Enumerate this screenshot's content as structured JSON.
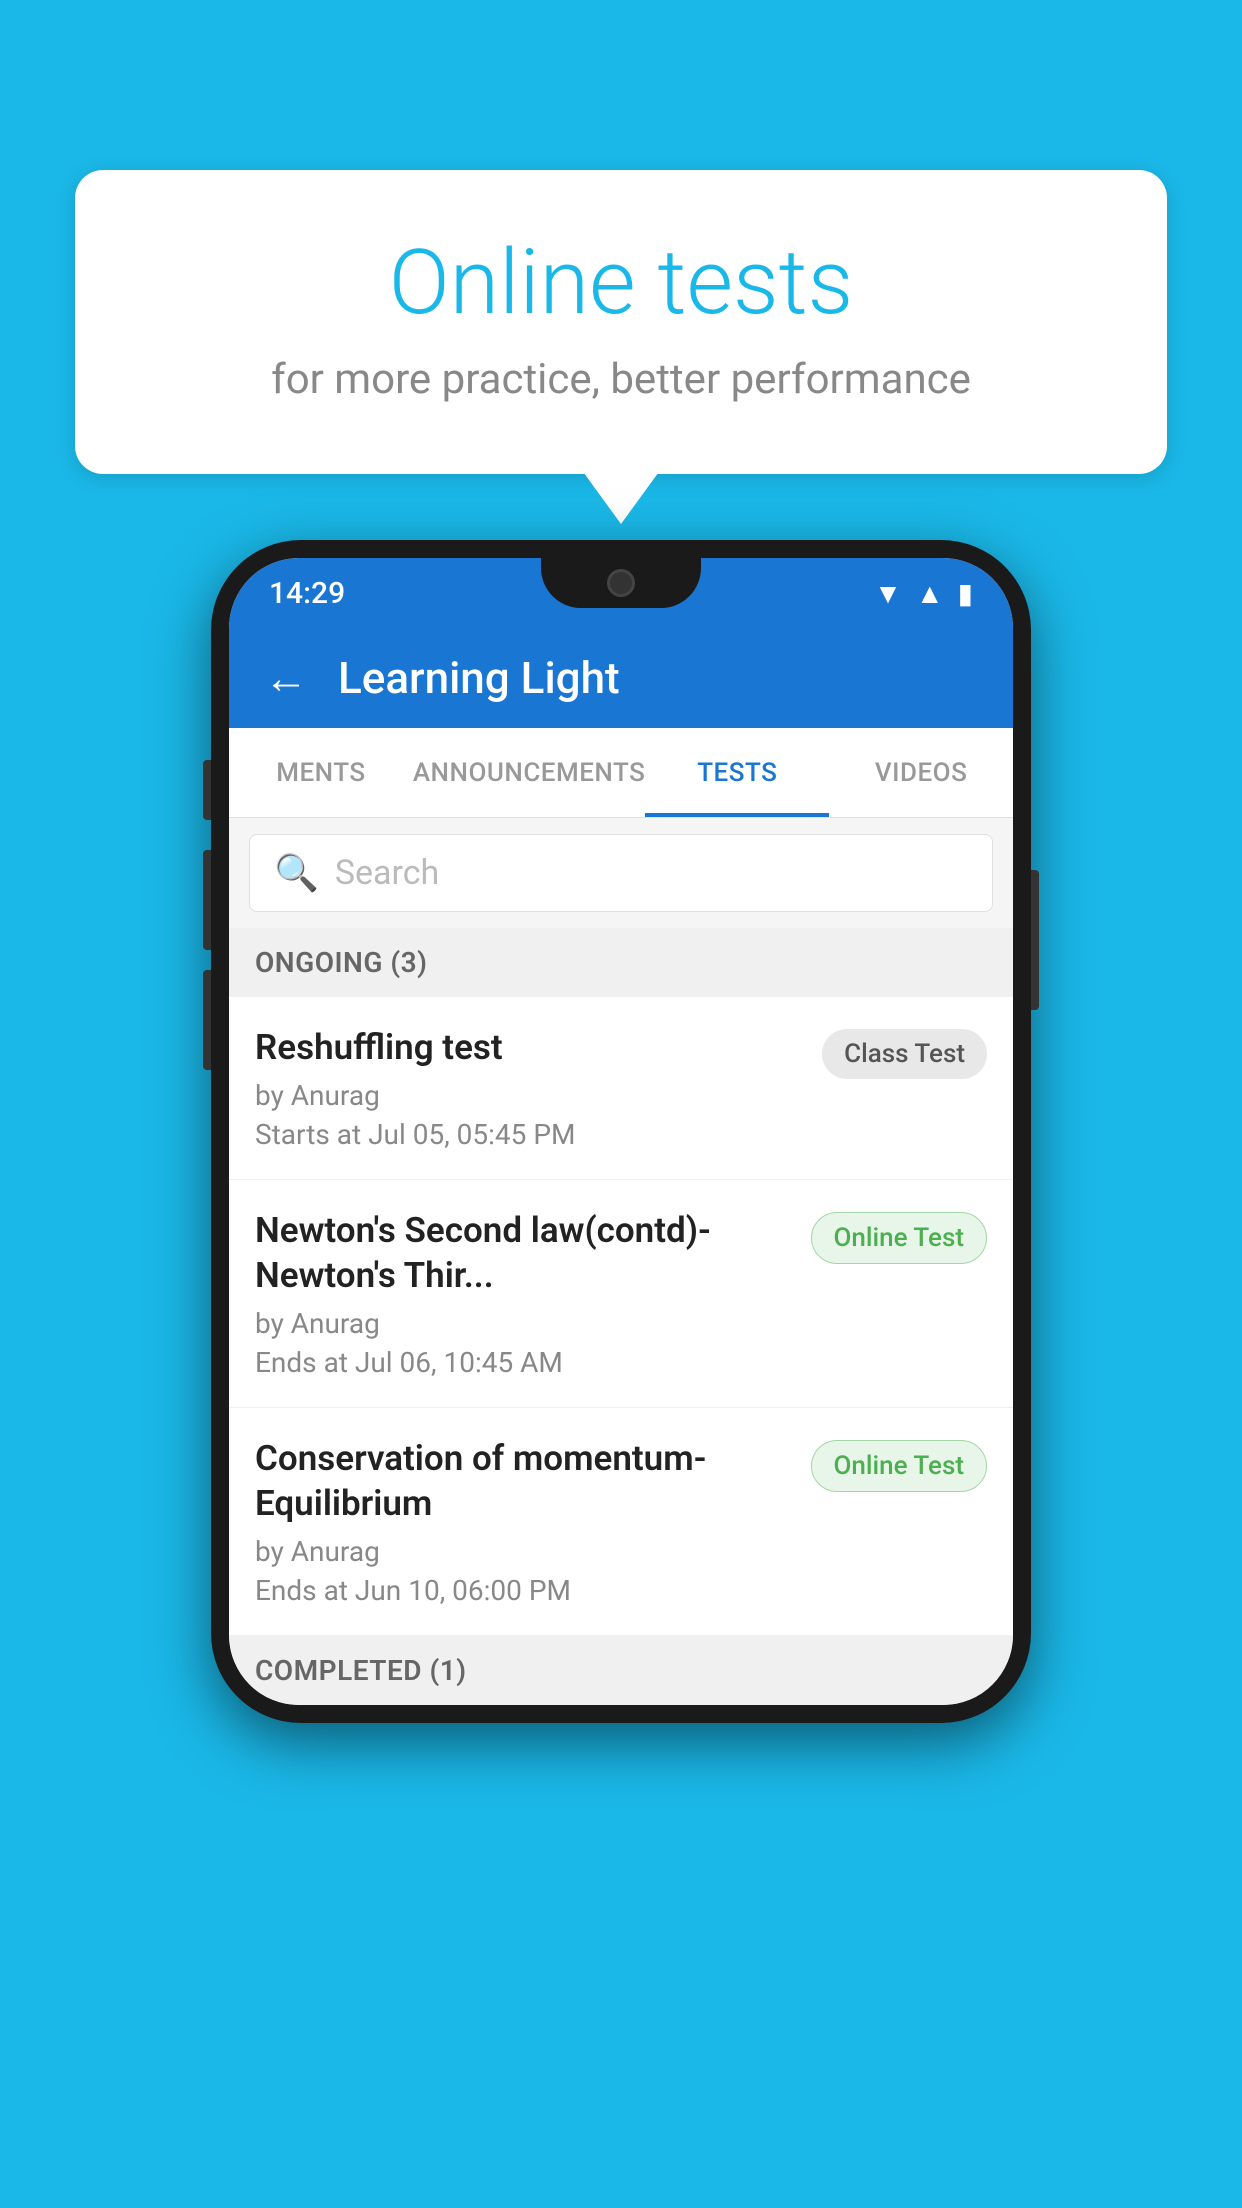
{
  "background": {
    "color": "#1ab8e8"
  },
  "speech_bubble": {
    "title": "Online tests",
    "subtitle": "for more practice, better performance"
  },
  "phone": {
    "status_bar": {
      "time": "14:29",
      "icons": [
        "wifi",
        "signal",
        "battery"
      ]
    },
    "app_bar": {
      "title": "Learning Light",
      "back_label": "←"
    },
    "tabs": [
      {
        "label": "MENTS",
        "active": false
      },
      {
        "label": "ANNOUNCEMENTS",
        "active": false
      },
      {
        "label": "TESTS",
        "active": true
      },
      {
        "label": "VIDEOS",
        "active": false
      }
    ],
    "search": {
      "placeholder": "Search"
    },
    "ongoing_section": {
      "label": "ONGOING (3)"
    },
    "tests": [
      {
        "name": "Reshuffling test",
        "by": "by Anurag",
        "time_label": "Starts at",
        "time": "Jul 05, 05:45 PM",
        "badge": "Class Test",
        "badge_type": "class"
      },
      {
        "name": "Newton's Second law(contd)-Newton's Thir...",
        "by": "by Anurag",
        "time_label": "Ends at",
        "time": "Jul 06, 10:45 AM",
        "badge": "Online Test",
        "badge_type": "online"
      },
      {
        "name": "Conservation of momentum-Equilibrium",
        "by": "by Anurag",
        "time_label": "Ends at",
        "time": "Jun 10, 06:00 PM",
        "badge": "Online Test",
        "badge_type": "online"
      }
    ],
    "completed_section": {
      "label": "COMPLETED (1)"
    }
  }
}
